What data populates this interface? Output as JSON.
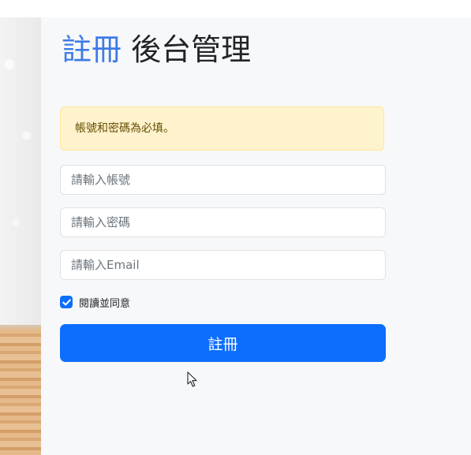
{
  "title": {
    "accent": "註冊",
    "main": "後台管理"
  },
  "alert": {
    "message": "帳號和密碼為必填。"
  },
  "form": {
    "username_placeholder": "請輸入帳號",
    "username_value": "",
    "password_placeholder": "請輸入密碼",
    "password_value": "",
    "email_placeholder": "請輸入Email",
    "email_value": "",
    "agree_label": "閱讀並同意",
    "agree_checked": true,
    "submit_label": "註冊"
  },
  "colors": {
    "primary": "#0d6efd",
    "title_accent": "#3e7be6",
    "alert_background": "#fff3cd",
    "alert_text": "#664d03"
  },
  "icons": [
    "checkmark-icon",
    "mouse-cursor-icon"
  ]
}
